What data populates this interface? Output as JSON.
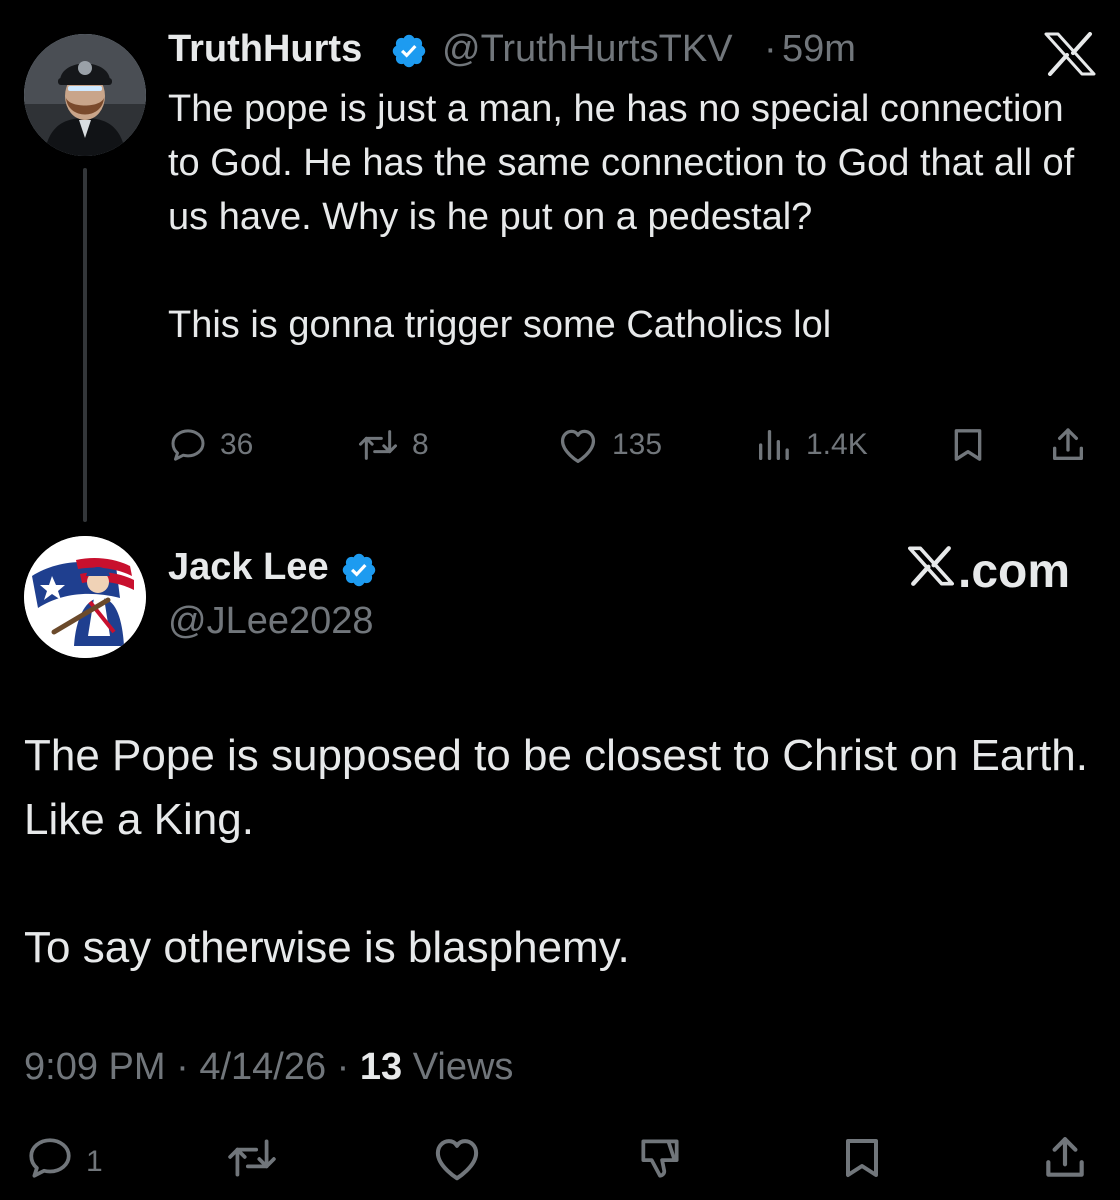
{
  "parent_tweet": {
    "author_name": "TruthHurts",
    "handle": "@TruthHurtsTKV",
    "separator": "·",
    "time": "59m",
    "paragraphs": [
      "The pope is just a man, he has no special connection to God. He has the same connection to God that all of us have. Why is he put on a pedestal?",
      "This is gonna trigger some Catholics lol"
    ],
    "stats": {
      "replies": "36",
      "reposts": "8",
      "likes": "135",
      "views": "1.4K"
    }
  },
  "reply_tweet": {
    "author_name": "Jack Lee",
    "handle": "@JLee2028",
    "brand": ".com",
    "paragraphs": [
      "The Pope is supposed to be closest to Christ on Earth. Like a King.",
      "To say otherwise is blasphemy."
    ],
    "time": "9:09 PM",
    "date": "4/14/26",
    "separator": "·",
    "views_count": "13",
    "views_label": "Views",
    "stats": {
      "replies": "1"
    }
  },
  "colors": {
    "background": "#000000",
    "text_primary": "#e7e9ea",
    "text_secondary": "#71767b",
    "verified_badge": "#1d9bf0",
    "thread_line": "#333639"
  },
  "icons": {
    "verified": "verified-badge-icon",
    "x_logo": "x-logo-icon",
    "reply": "reply-icon",
    "repost": "repost-icon",
    "like": "heart-icon",
    "views": "views-chart-icon",
    "bookmark": "bookmark-icon",
    "share": "share-icon",
    "dislike": "thumbs-down-icon"
  }
}
